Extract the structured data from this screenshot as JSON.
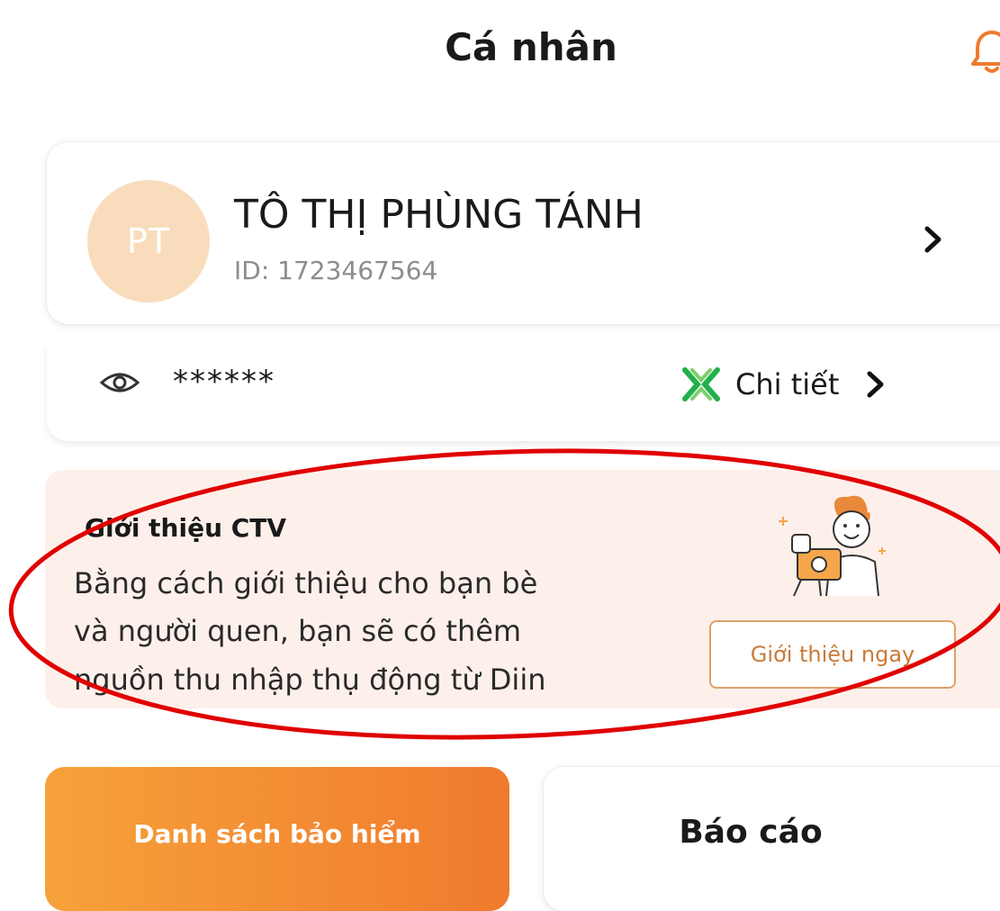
{
  "header": {
    "title": "Cá nhân"
  },
  "profile": {
    "avatar_initials": "PT",
    "name": "TÔ THỊ PHÙNG TÁNH",
    "id_text": "ID: 1723467564"
  },
  "balance": {
    "masked_value": "******",
    "detail_label": "Chi tiết"
  },
  "referral": {
    "title": "Giới thiệu CTV",
    "description_lines": [
      "Bằng cách giới thiệu cho bạn bè",
      "và người quen, bạn sẽ có thêm",
      "nguồn thu nhập thụ động từ Diin"
    ],
    "button_label": "Giới thiệu ngay"
  },
  "actions": {
    "insurance_list_label": "Danh sách bảo hiểm",
    "report_label": "Báo cáo"
  },
  "icons": {
    "bell": "bell-icon",
    "eye": "eye-icon",
    "brand": "x-logo-icon",
    "chevron": "chevron-right-icon"
  },
  "colors": {
    "accent_orange": "#f07a2e",
    "brand_green": "#22b04b",
    "referral_bg": "#fdf0ea",
    "annotation_red": "#e00000"
  }
}
